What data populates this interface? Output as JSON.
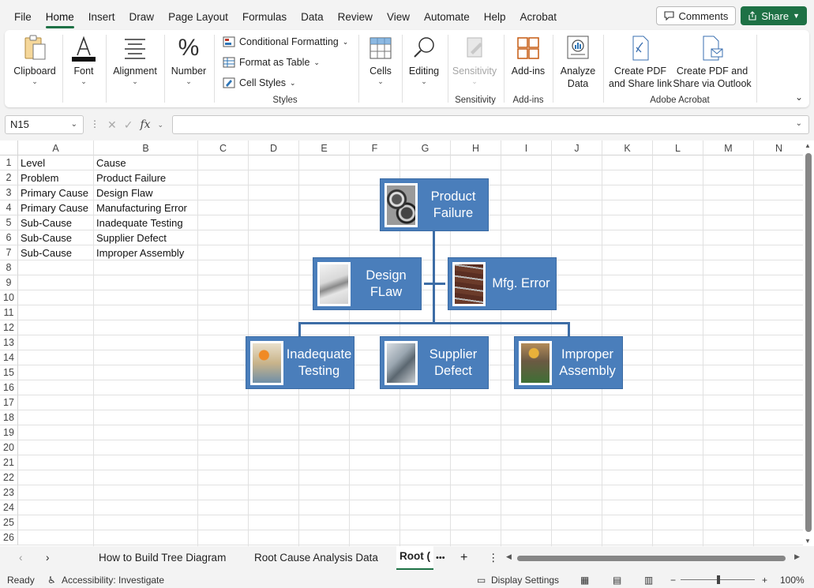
{
  "menu": {
    "items": [
      "File",
      "Home",
      "Insert",
      "Draw",
      "Page Layout",
      "Formulas",
      "Data",
      "Review",
      "View",
      "Automate",
      "Help",
      "Acrobat"
    ],
    "active": "Home",
    "comments_label": "Comments",
    "share_label": "Share"
  },
  "ribbon": {
    "clipboard": "Clipboard",
    "font": "Font",
    "alignment": "Alignment",
    "number": "Number",
    "conditional_formatting": "Conditional Formatting",
    "format_as_table": "Format as Table",
    "cell_styles": "Cell Styles",
    "styles_group": "Styles",
    "cells": "Cells",
    "editing": "Editing",
    "sensitivity_btn": "Sensitivity",
    "sensitivity_group": "Sensitivity",
    "addins_btn": "Add-ins",
    "addins_group": "Add-ins",
    "analyze_data_1": "Analyze",
    "analyze_data_2": "Data",
    "create_pdf_1": "Create PDF",
    "create_pdf_2": "and Share link",
    "create_pdf_outlook_1": "Create PDF and",
    "create_pdf_outlook_2": "Share via Outlook",
    "adobe_group": "Adobe Acrobat"
  },
  "formula_bar": {
    "name_box": "N15",
    "fx": "fx",
    "formula": ""
  },
  "columns": [
    "A",
    "B",
    "C",
    "D",
    "E",
    "F",
    "G",
    "H",
    "I",
    "J",
    "K",
    "L",
    "M",
    "N"
  ],
  "rows": [
    "1",
    "2",
    "3",
    "4",
    "5",
    "6",
    "7",
    "8",
    "9",
    "10",
    "11",
    "12",
    "13",
    "14",
    "15",
    "16",
    "17",
    "18",
    "19",
    "20",
    "21",
    "22",
    "23",
    "24",
    "25",
    "26"
  ],
  "table": {
    "rows": [
      [
        "Level",
        "Cause"
      ],
      [
        "Problem",
        "Product Failure"
      ],
      [
        "Primary Cause",
        "Design Flaw"
      ],
      [
        "Primary Cause",
        "Manufacturing Error"
      ],
      [
        "Sub-Cause",
        "Inadequate Testing"
      ],
      [
        "Sub-Cause",
        "Supplier Defect"
      ],
      [
        "Sub-Cause",
        "Improper Assembly"
      ]
    ]
  },
  "diagram": {
    "root": {
      "line1": "Product",
      "line2": "Failure"
    },
    "design": {
      "line1": "Design",
      "line2": "FLaw"
    },
    "mfg": {
      "line1": "Mfg. Error",
      "line2": ""
    },
    "testing": {
      "line1": "Inadequate",
      "line2": "Testing"
    },
    "supplier": {
      "line1": "Supplier",
      "line2": "Defect"
    },
    "assembly": {
      "line1": "Improper",
      "line2": "Assembly"
    },
    "node_color": "#4a7ebb",
    "connector_color": "#3d6da6"
  },
  "tabs": {
    "sheet1": "How to Build Tree Diagram",
    "sheet2": "Root Cause Analysis Data",
    "sheet3": "Root (",
    "more": "•••",
    "add": "+"
  },
  "status": {
    "ready": "Ready",
    "accessibility": "Accessibility: Investigate",
    "display_settings": "Display Settings",
    "zoom": "100%"
  },
  "colors": {
    "accent": "#1e7145"
  }
}
